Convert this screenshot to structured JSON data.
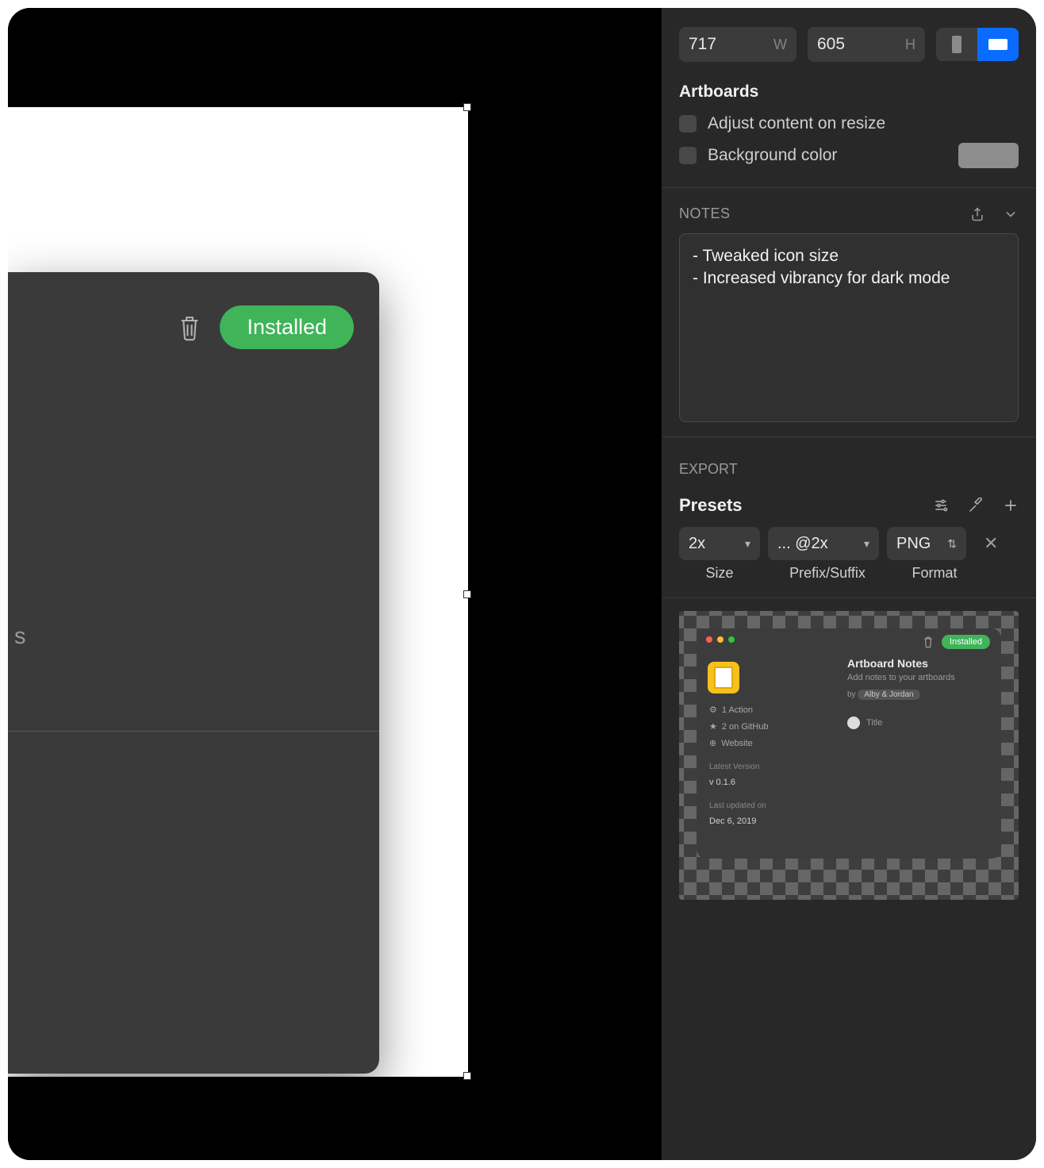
{
  "canvas": {
    "installed_label": "Installed",
    "side_letter": "s"
  },
  "dimensions": {
    "width": "717",
    "width_unit": "W",
    "height": "605",
    "height_unit": "H"
  },
  "artboards": {
    "title": "Artboards",
    "adjust_label": "Adjust content on resize",
    "bg_label": "Background color",
    "bg_color": "#8d8d8d"
  },
  "notes": {
    "header": "NOTES",
    "content": "- Tweaked icon size\n- Increased vibrancy for dark mode"
  },
  "export": {
    "header": "EXPORT",
    "presets_label": "Presets",
    "size_value": "2x",
    "prefix_value": "... @2x",
    "format_value": "PNG",
    "size_label": "Size",
    "prefix_label": "Prefix/Suffix",
    "format_label": "Format"
  },
  "preview": {
    "installed": "Installed",
    "title": "Artboard Notes",
    "subtitle": "Add notes to your artboards",
    "by": "by",
    "author": "Alby & Jordan",
    "row_title": "Title",
    "action": "1 Action",
    "github": "2 on GitHub",
    "website": "Website",
    "latest_label": "Latest Version",
    "latest_value": "v 0.1.6",
    "updated_label": "Last updated on",
    "updated_value": "Dec 6, 2019"
  }
}
